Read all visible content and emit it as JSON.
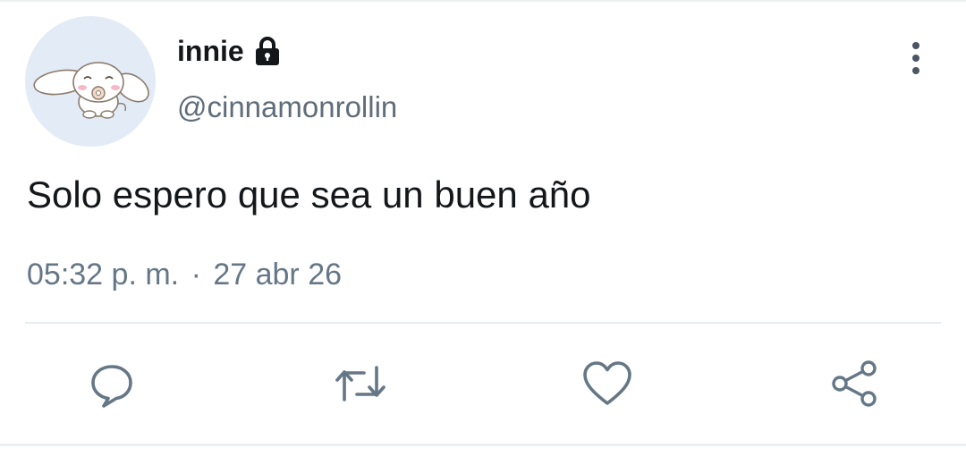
{
  "tweet": {
    "display_name": "innie",
    "handle": "@cinnamonrollin",
    "text": "Solo espero que sea un buen año",
    "time": "05:32 p. m.",
    "separator": "·",
    "date": "27 abr 26",
    "protected": true
  },
  "icons": {
    "avatar": "cinnamoroll-avatar",
    "lock": "lock-icon",
    "more": "more-vertical-icon",
    "reply": "reply-icon",
    "retweet": "retweet-icon",
    "like": "heart-icon",
    "share": "share-icon"
  },
  "colors": {
    "text_primary": "#14171a",
    "text_secondary": "#657786",
    "icon_gray": "#657786",
    "avatar_bg": "#e3ebf7",
    "divider": "#e6ecf0"
  }
}
